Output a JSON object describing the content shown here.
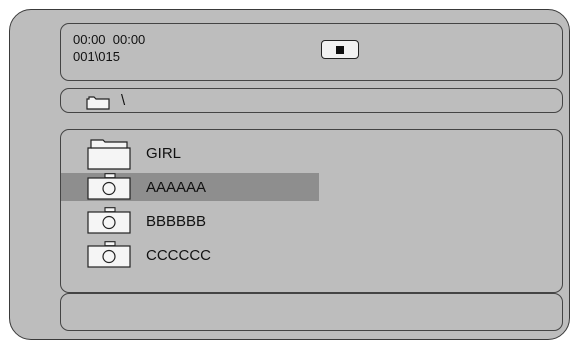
{
  "status": {
    "time": "00:00  00:00",
    "track": "001\\015",
    "stop_icon": "stop-icon"
  },
  "path": {
    "icon": "folder-icon",
    "text": "\\"
  },
  "file_list": {
    "items": [
      {
        "label": "GIRL",
        "icon": "folder-icon",
        "selected": false
      },
      {
        "label": "AAAAAA",
        "icon": "photo-file-icon",
        "selected": true
      },
      {
        "label": "BBBBBB",
        "icon": "photo-file-icon",
        "selected": false
      },
      {
        "label": "CCCCCC",
        "icon": "photo-file-icon",
        "selected": false
      }
    ]
  },
  "colors": {
    "background": "#bdbdbd",
    "selection": "#8e8e8e",
    "border": "#444444"
  }
}
